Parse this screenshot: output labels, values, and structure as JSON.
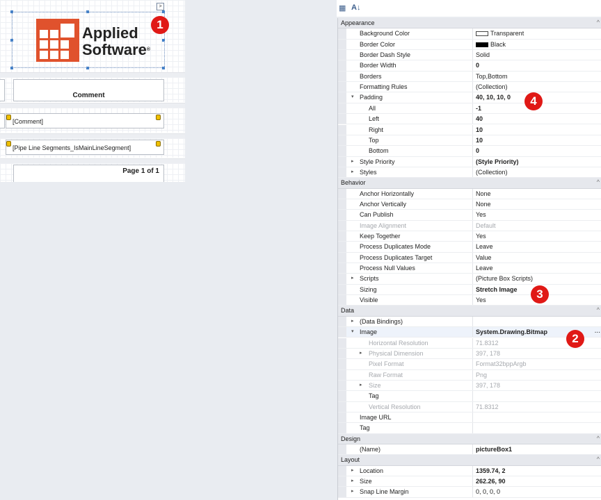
{
  "designer": {
    "logo_line1": "Applied",
    "logo_line2": "Software",
    "logo_reg": "®",
    "smart_tag": ">",
    "comment_header": "Comment",
    "comment_field": "[Comment]",
    "pipeline_field": "[Pipe Line Segments_IsMainLineSegment]",
    "page_info": "Page 1 of 1"
  },
  "toolbar": {
    "categorized_icon": "categorized-view-icon",
    "sort_icon": "alphabetical-sort-icon",
    "categorized_glyph": "▦",
    "sort_glyph": "A↓"
  },
  "properties": {
    "appearance": {
      "title": "Appearance",
      "background_color": {
        "name": "Background Color",
        "value": "Transparent"
      },
      "border_color": {
        "name": "Border Color",
        "value": "Black"
      },
      "border_dash_style": {
        "name": "Border Dash Style",
        "value": "Solid"
      },
      "border_width": {
        "name": "Border Width",
        "value": "0"
      },
      "borders": {
        "name": "Borders",
        "value": "Top,Bottom"
      },
      "formatting_rules": {
        "name": "Formatting Rules",
        "value": "(Collection)"
      },
      "padding": {
        "name": "Padding",
        "value": "40, 10, 10, 0"
      },
      "padding_all": {
        "name": "All",
        "value": "-1"
      },
      "padding_left": {
        "name": "Left",
        "value": "40"
      },
      "padding_right": {
        "name": "Right",
        "value": "10"
      },
      "padding_top": {
        "name": "Top",
        "value": "10"
      },
      "padding_bottom": {
        "name": "Bottom",
        "value": "0"
      },
      "style_priority": {
        "name": "Style Priority",
        "value": "(Style Priority)"
      },
      "styles": {
        "name": "Styles",
        "value": "(Collection)"
      }
    },
    "behavior": {
      "title": "Behavior",
      "anchor_h": {
        "name": "Anchor Horizontally",
        "value": "None"
      },
      "anchor_v": {
        "name": "Anchor Vertically",
        "value": "None"
      },
      "can_publish": {
        "name": "Can Publish",
        "value": "Yes"
      },
      "image_alignment": {
        "name": "Image Alignment",
        "value": "Default"
      },
      "keep_together": {
        "name": "Keep Together",
        "value": "Yes"
      },
      "proc_dup_mode": {
        "name": "Process Duplicates Mode",
        "value": "Leave"
      },
      "proc_dup_target": {
        "name": "Process Duplicates Target",
        "value": "Value"
      },
      "proc_null": {
        "name": "Process Null Values",
        "value": "Leave"
      },
      "scripts": {
        "name": "Scripts",
        "value": "(Picture Box Scripts)"
      },
      "sizing": {
        "name": "Sizing",
        "value": "Stretch Image"
      },
      "visible": {
        "name": "Visible",
        "value": "Yes"
      }
    },
    "data": {
      "title": "Data",
      "data_bindings": {
        "name": "(Data Bindings)",
        "value": ""
      },
      "image": {
        "name": "Image",
        "value": "System.Drawing.Bitmap",
        "ellipsis": "..."
      },
      "h_res": {
        "name": "Horizontal Resolution",
        "value": "71.8312"
      },
      "phys_dim": {
        "name": "Physical Dimension",
        "value": "397, 178"
      },
      "pixel_format": {
        "name": "Pixel Format",
        "value": "Format32bppArgb"
      },
      "raw_format": {
        "name": "Raw Format",
        "value": "Png"
      },
      "size": {
        "name": "Size",
        "value": "397, 178"
      },
      "tag_inner": {
        "name": "Tag",
        "value": ""
      },
      "v_res": {
        "name": "Vertical Resolution",
        "value": "71.8312"
      },
      "image_url": {
        "name": "Image URL",
        "value": ""
      },
      "tag": {
        "name": "Tag",
        "value": ""
      }
    },
    "design": {
      "title": "Design",
      "name": {
        "name": "(Name)",
        "value": "pictureBox1"
      }
    },
    "layout": {
      "title": "Layout",
      "location": {
        "name": "Location",
        "value": "1359.74, 2"
      },
      "size": {
        "name": "Size",
        "value": "262.26, 90"
      },
      "snap_margin": {
        "name": "Snap Line Margin",
        "value": "0, 0, 0, 0"
      }
    }
  },
  "markers": {
    "m1": "1",
    "m2": "2",
    "m3": "3",
    "m4": "4"
  },
  "colors": {
    "logo_orange": "#e0522d",
    "marker_red": "#e01916"
  }
}
